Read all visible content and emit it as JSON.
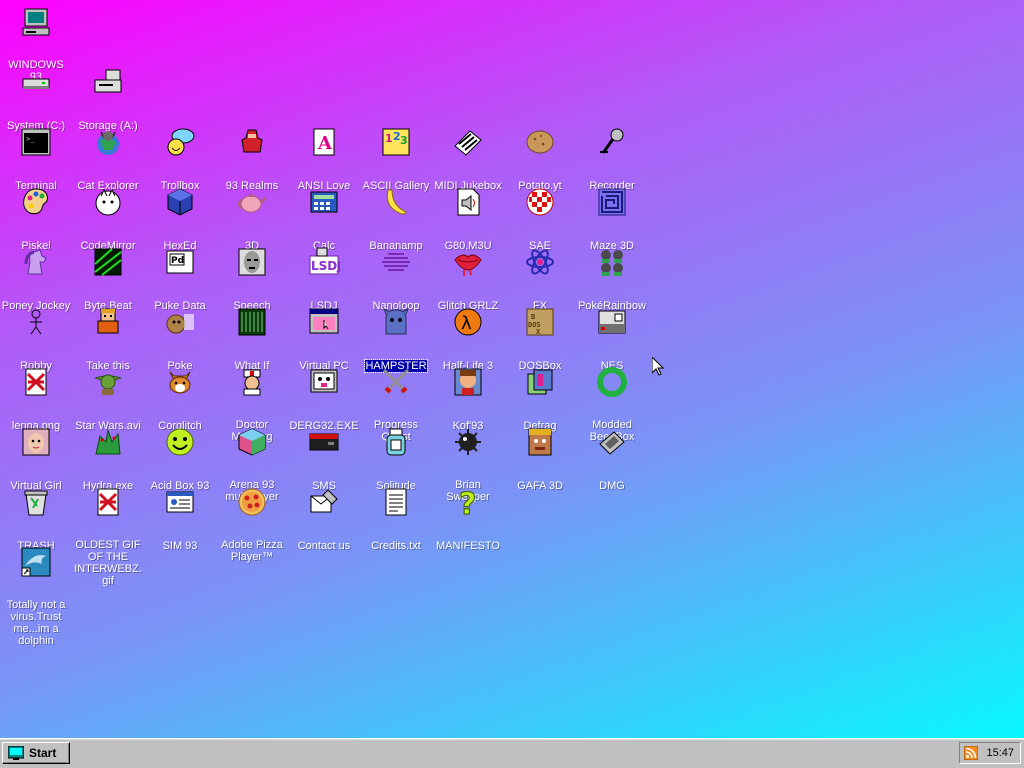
{
  "desktop": {
    "icons": [
      {
        "label": "WINDOWS 93",
        "icon": "computer-icon"
      },
      {
        "label": "System (C:)",
        "icon": "hard-drive-icon"
      },
      {
        "label": "Storage (A:)",
        "icon": "floppy-drive-icon"
      },
      {
        "label": "Terminal",
        "icon": "terminal-icon"
      },
      {
        "label": "Cat Explorer",
        "icon": "cat-explorer-icon"
      },
      {
        "label": "Trollbox",
        "icon": "trollbox-icon"
      },
      {
        "label": "93 Realms",
        "icon": "realms-icon"
      },
      {
        "label": "ANSI Love",
        "icon": "ansi-icon"
      },
      {
        "label": "ASCII Gallery",
        "icon": "ascii-icon"
      },
      {
        "label": "MIDI Jukebox",
        "icon": "piano-icon"
      },
      {
        "label": "Potato.yt",
        "icon": "potato-icon"
      },
      {
        "label": "Recorder",
        "icon": "microphone-icon"
      },
      {
        "label": "Piskel",
        "icon": "palette-icon"
      },
      {
        "label": "CodeMirror",
        "icon": "codemirror-icon"
      },
      {
        "label": "HexEd",
        "icon": "hexed-icon"
      },
      {
        "label": "3D",
        "icon": "teapot-icon"
      },
      {
        "label": "Calc",
        "icon": "calculator-icon"
      },
      {
        "label": "Bananamp",
        "icon": "banana-icon"
      },
      {
        "label": "G80.M3U",
        "icon": "audio-file-icon"
      },
      {
        "label": "SAE",
        "icon": "amiga-ball-icon"
      },
      {
        "label": "Maze 3D",
        "icon": "maze-icon"
      },
      {
        "label": "Poney Jockey",
        "icon": "pony-icon"
      },
      {
        "label": "Byte Beat",
        "icon": "bytebeat-icon"
      },
      {
        "label": "Puke Data",
        "icon": "puredata-icon"
      },
      {
        "label": "Speech",
        "icon": "speech-icon"
      },
      {
        "label": "LSDJ",
        "icon": "lsdj-icon"
      },
      {
        "label": "Nanoloop",
        "icon": "nanoloop-icon"
      },
      {
        "label": "Glitch GRLZ",
        "icon": "lips-icon"
      },
      {
        "label": "FX",
        "icon": "atom-icon"
      },
      {
        "label": "PokéRainbow",
        "icon": "pokerainbow-icon"
      },
      {
        "label": "Robby",
        "icon": "stick-figure-icon"
      },
      {
        "label": "Take this",
        "icon": "take-this-icon"
      },
      {
        "label": "Poke",
        "icon": "poke-icon"
      },
      {
        "label": "What If",
        "icon": "whatif-icon"
      },
      {
        "label": "Virtual PC",
        "icon": "virtual-pc-icon"
      },
      {
        "label": "HAMPSTER",
        "icon": "hampster-icon"
      },
      {
        "label": "Half-Life 3",
        "icon": "half-life-icon"
      },
      {
        "label": "DOSBox",
        "icon": "dosbox-icon"
      },
      {
        "label": "NES",
        "icon": "nes-icon"
      },
      {
        "label": "lenna.png",
        "icon": "image-file-icon"
      },
      {
        "label": "Star Wars.avi",
        "icon": "yoda-icon"
      },
      {
        "label": "Corglitch",
        "icon": "corgi-icon"
      },
      {
        "label": "Doctor Marburg",
        "icon": "doctor-icon"
      },
      {
        "label": "DERG32.EXE",
        "icon": "derg-icon"
      },
      {
        "label": "Progress Quest",
        "icon": "swords-icon"
      },
      {
        "label": "Kof'93",
        "icon": "fighter-icon"
      },
      {
        "label": "Defrag",
        "icon": "defrag-icon"
      },
      {
        "label": "Modded BeepBox",
        "icon": "beepbox-icon"
      },
      {
        "label": "Virtual Girl",
        "icon": "girl-face-icon"
      },
      {
        "label": "Hydra.exe",
        "icon": "hydra-icon"
      },
      {
        "label": "Acid Box 93",
        "icon": "smiley-icon"
      },
      {
        "label": "Arena 93 multiplayer",
        "icon": "cube-icon"
      },
      {
        "label": "SMS",
        "icon": "sms-console-icon"
      },
      {
        "label": "Solitude",
        "icon": "solitude-icon"
      },
      {
        "label": "Brian Sweeper",
        "icon": "mine-icon"
      },
      {
        "label": "GAFA 3D",
        "icon": "gafa-icon"
      },
      {
        "label": "DMG",
        "icon": "gameboy-icon"
      },
      {
        "label": "TRASH",
        "icon": "trash-icon"
      },
      {
        "label": "OLDEST GIF OF THE INTERWEBZ.gif",
        "icon": "gif-file-icon"
      },
      {
        "label": "SIM 93",
        "icon": "sim-icon"
      },
      {
        "label": "Adobe Pizza Player™",
        "icon": "pizza-icon"
      },
      {
        "label": "Contact us",
        "icon": "contact-icon"
      },
      {
        "label": "Credits.txt",
        "icon": "text-file-icon"
      },
      {
        "label": "MANIFESTO",
        "icon": "question-icon"
      },
      {
        "label": "Totally not a virus.Trust me...im a dolphin",
        "icon": "dolphin-icon"
      }
    ],
    "selected": "HAMPSTER"
  },
  "taskbar": {
    "start_label": "Start",
    "clock": "15:47",
    "tray_icon": "rss-icon"
  },
  "colors": {
    "gradient_start": "#ff00ff",
    "gradient_end": "#00ffff",
    "taskbar": "#c0c0c0",
    "selection": "#0000aa"
  }
}
